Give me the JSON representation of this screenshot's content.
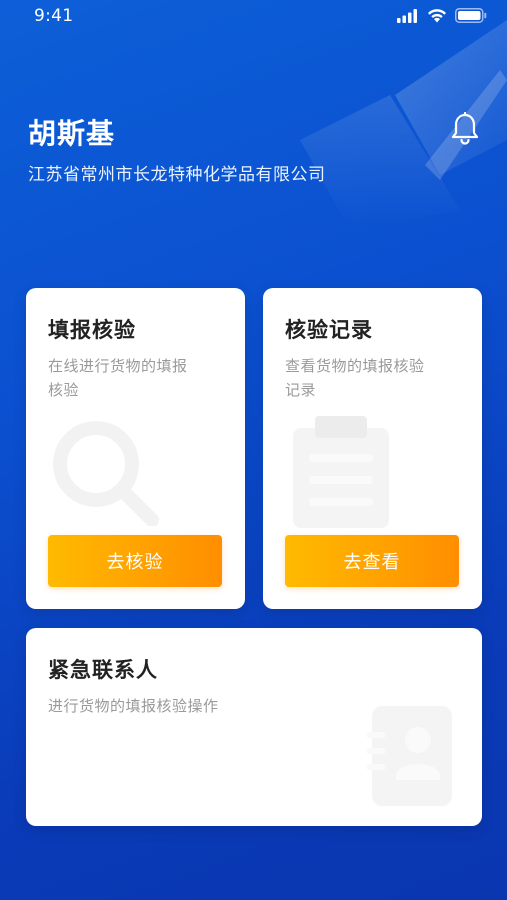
{
  "status_bar": {
    "time": "9:41",
    "icons": [
      "signal-icon",
      "wifi-icon",
      "battery-icon"
    ]
  },
  "header": {
    "user_name": "胡斯基",
    "company": "江苏省常州市长龙特种化学品有限公司",
    "notification_icon": "bell-icon"
  },
  "cards": {
    "fill_verify": {
      "title": "填报核验",
      "desc_line1": "在线进行货物的填报",
      "desc_line2": "核验",
      "button": "去核验",
      "icon": "search-icon"
    },
    "verify_records": {
      "title": "核验记录",
      "desc_line1": "查看货物的填报核验",
      "desc_line2": "记录",
      "button": "去查看",
      "icon": "clipboard-icon"
    },
    "emergency_contact": {
      "title": "紧急联系人",
      "desc": "进行货物的填报核验操作",
      "icon": "contact-card-icon"
    }
  },
  "colors": {
    "background": "#0b4fcf",
    "button_gradient_start": "#ffba00",
    "button_gradient_end": "#ff8e00",
    "title_text": "#222222",
    "desc_text": "#9a9a9a"
  }
}
